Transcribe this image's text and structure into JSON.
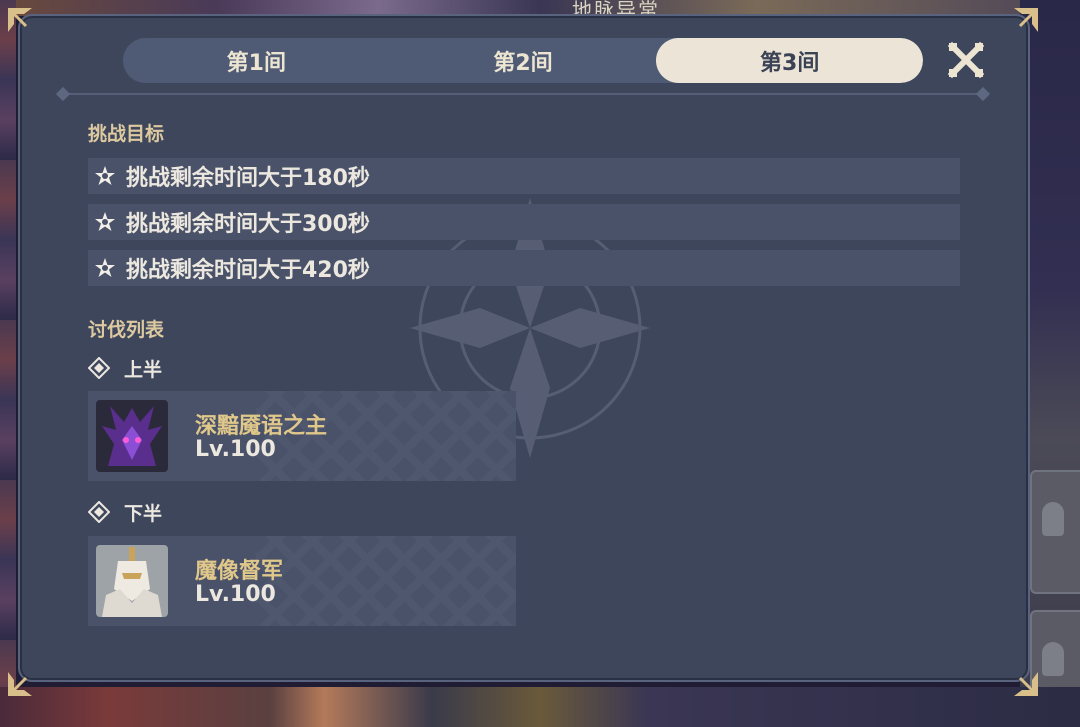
{
  "background": {
    "top_text": "地脉异常"
  },
  "tabs": [
    {
      "label": "第1间",
      "active": false
    },
    {
      "label": "第2间",
      "active": false
    },
    {
      "label": "第3间",
      "active": true
    }
  ],
  "close_icon": "close-x-icon",
  "challenge_goals": {
    "title": "挑战目标",
    "items": [
      {
        "text": "挑战剩余时间大于180秒",
        "icon": "star-icon"
      },
      {
        "text": "挑战剩余时间大于300秒",
        "icon": "star-icon"
      },
      {
        "text": "挑战剩余时间大于420秒",
        "icon": "star-icon"
      }
    ]
  },
  "enemy_list": {
    "title": "讨伐列表",
    "first_half": {
      "label": "上半",
      "enemy": {
        "name": "深黯魇语之主",
        "level": "Lv.100",
        "portrait": "dark-purple-boss-portrait"
      }
    },
    "second_half": {
      "label": "下半",
      "enemy": {
        "name": "魔像督军",
        "level": "Lv.100",
        "portrait": "white-armored-golem-portrait"
      }
    }
  },
  "colors": {
    "panel_bg": "#3e465c",
    "row_bg": "#4a5269",
    "section_title": "#dcc9a0",
    "enemy_name": "#e0c78a",
    "tab_active_bg": "#ece5d7"
  }
}
